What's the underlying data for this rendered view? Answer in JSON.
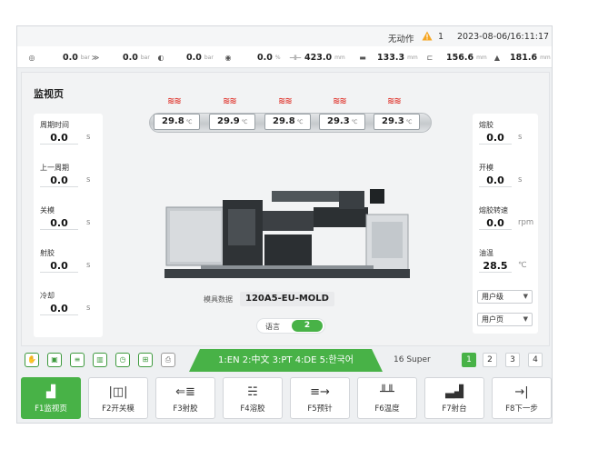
{
  "status_bar": {
    "machine_status": "无动作",
    "alarm_count": "1",
    "datetime": "2023-08-06/16:11:17"
  },
  "params": [
    {
      "icon": "pressure-icon",
      "value": "0.0",
      "unit": "bar"
    },
    {
      "icon": "flow-icon",
      "value": "0.0",
      "unit": "bar"
    },
    {
      "icon": "gauge-icon",
      "value": "0.0",
      "unit": "bar"
    },
    {
      "icon": "speed-icon",
      "value": "0.0",
      "unit": "%"
    },
    {
      "icon": "mold-position-icon",
      "value": "423.0",
      "unit": "mm"
    },
    {
      "icon": "ejector-position-icon",
      "value": "133.3",
      "unit": "mm"
    },
    {
      "icon": "screw-position-icon",
      "value": "156.6",
      "unit": "mm"
    },
    {
      "icon": "carriage-position-icon",
      "value": "181.6",
      "unit": "mm"
    }
  ],
  "page_title": "监视页",
  "heaters": [
    {
      "value": "29.8",
      "unit": "℃"
    },
    {
      "value": "29.9",
      "unit": "℃"
    },
    {
      "value": "29.8",
      "unit": "℃"
    },
    {
      "value": "29.3",
      "unit": "℃"
    },
    {
      "value": "29.3",
      "unit": "℃"
    }
  ],
  "left_metrics": [
    {
      "label": "周期时间",
      "value": "0.0",
      "unit": "s"
    },
    {
      "label": "上一周期",
      "value": "0.0",
      "unit": "s"
    },
    {
      "label": "关模",
      "value": "0.0",
      "unit": "s"
    },
    {
      "label": "射胶",
      "value": "0.0",
      "unit": "s"
    },
    {
      "label": "冷却",
      "value": "0.0",
      "unit": "s"
    }
  ],
  "right_metrics": [
    {
      "label": "熔胶",
      "value": "0.0",
      "unit": "s"
    },
    {
      "label": "开模",
      "value": "0.0",
      "unit": "s"
    },
    {
      "label": "熔胶转速",
      "value": "0.0",
      "unit": "rpm"
    },
    {
      "label": "油温",
      "value": "28.5",
      "unit": "℃"
    }
  ],
  "right_dropdowns": [
    {
      "value": "用户级"
    },
    {
      "value": "用户页"
    }
  ],
  "mold": {
    "label": "模具数据",
    "name": "120A5-EU-MOLD"
  },
  "language": {
    "label": "语言",
    "value": "2"
  },
  "language_banner": "1:EN 2:中文 3:PT 4:DE 5:한국어",
  "super_label": "16 Super",
  "pages": [
    "1",
    "2",
    "3",
    "4"
  ],
  "function_keys": [
    {
      "label": "F1监视页",
      "icon": "chart-icon",
      "active": true
    },
    {
      "label": "F2开关模",
      "icon": "mold-open-close-icon",
      "active": false
    },
    {
      "label": "F3射胶",
      "icon": "injection-icon",
      "active": false
    },
    {
      "label": "F4溶胶",
      "icon": "melt-icon",
      "active": false
    },
    {
      "label": "F5预针",
      "icon": "preset-icon",
      "active": false
    },
    {
      "label": "F6温度",
      "icon": "temperature-icon",
      "active": false
    },
    {
      "label": "F7射台",
      "icon": "injection-unit-icon",
      "active": false
    },
    {
      "label": "F8下一步",
      "icon": "next-step-icon",
      "active": false
    }
  ],
  "colors": {
    "accent": "#48b247",
    "alarm": "#f5a623",
    "heater": "#e03a32"
  }
}
